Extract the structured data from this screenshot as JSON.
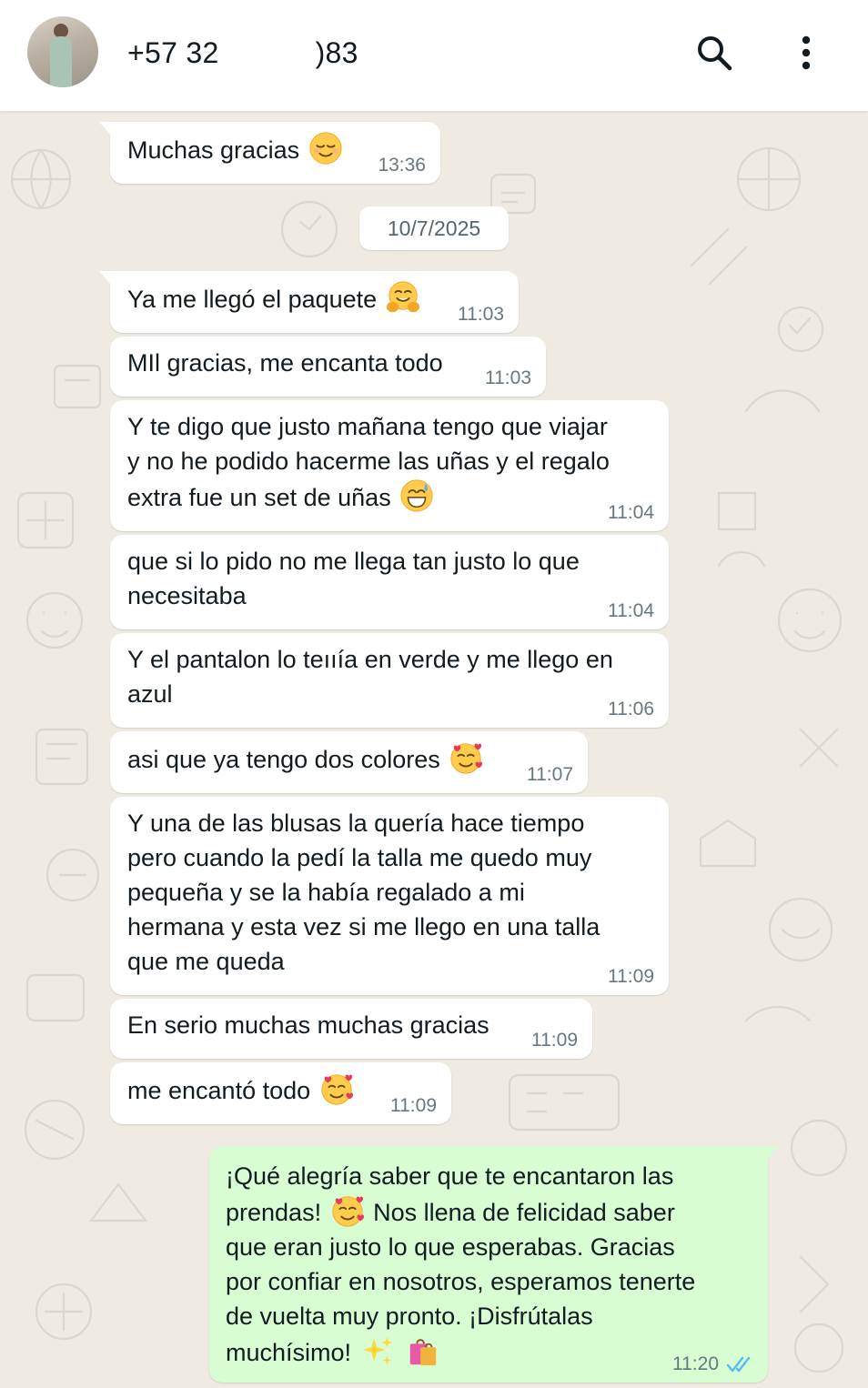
{
  "header": {
    "contact_name": "+57 32              )83",
    "search_icon": "search-icon",
    "menu_icon": "more-vertical-icon"
  },
  "date_separator": "10/7/2025",
  "messages": [
    {
      "text": "Muchas gracias",
      "emoji": "relieved",
      "time": "13:36",
      "direction": "in"
    },
    {
      "text": "Ya me llegó el paquete",
      "emoji": "hugging",
      "time": "11:03",
      "direction": "in"
    },
    {
      "text": "MIl gracias, me encanta todo",
      "time": "11:03",
      "direction": "in"
    },
    {
      "lines": [
        "Y te digo que justo mañana tengo que viajar",
        "y no he podido hacerme las uñas y el regalo",
        "extra fue un set de uñas"
      ],
      "emoji": "sweat-smile",
      "time": "11:04",
      "direction": "in"
    },
    {
      "lines": [
        "que si lo pido no me llega tan justo lo que",
        "necesitaba"
      ],
      "time": "11:04",
      "direction": "in"
    },
    {
      "lines": [
        "Y el pantalon lo teııía en verde y me llego en",
        "azul"
      ],
      "time": "11:06",
      "direction": "in"
    },
    {
      "text": "asi que ya tengo dos colores",
      "emoji": "smiling-hearts",
      "time": "11:07",
      "direction": "in"
    },
    {
      "lines": [
        "Y una de las blusas la quería hace tiempo",
        "pero cuando la pedí la talla me quedo muy",
        "pequeña y se la había regalado a mi",
        "hermana y esta vez si me llego en una talla",
        "que me queda"
      ],
      "time": "11:09",
      "direction": "in"
    },
    {
      "text": "En serio muchas muchas gracias",
      "time": "11:09",
      "direction": "in"
    },
    {
      "text": "me encantó todo",
      "emoji": "smiling-hearts",
      "time": "11:09",
      "direction": "in"
    },
    {
      "lines": [
        "¡Qué alegría saber que te encantaron las",
        "prendas!",
        " Nos llena de felicidad saber",
        "que eran justo lo que esperabas. Gracias",
        "por confiar en nosotros, esperamos tenerte",
        "de vuelta muy pronto. ¡Disfrútalas",
        "muchísimo!"
      ],
      "time": "11:20",
      "status": "read",
      "direction": "out"
    }
  ],
  "colors": {
    "chat_bg": "#efeae2",
    "incoming_bubble": "#ffffff",
    "outgoing_bubble": "#d9fdd3",
    "read_ticks": "#53bdeb",
    "timestamp": "#667781"
  }
}
